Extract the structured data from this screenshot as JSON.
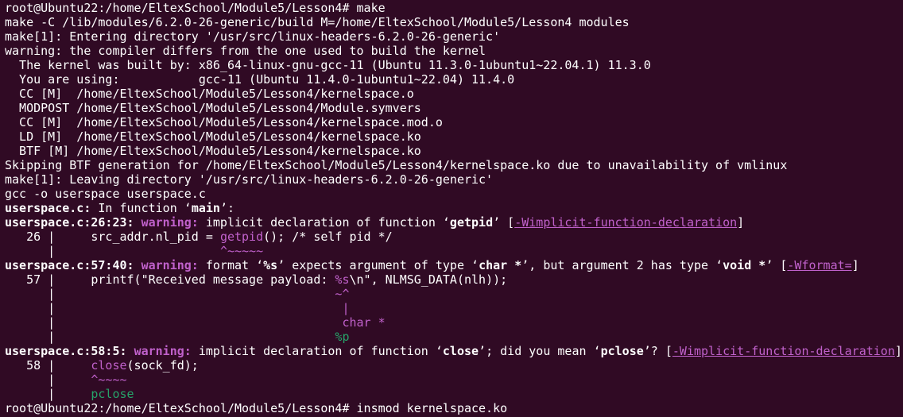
{
  "colors": {
    "background": "#300a24",
    "foreground": "#ffffff",
    "warning": "#c061cb",
    "fixit": "#26a269"
  },
  "lines": [
    [
      {
        "t": "root@Ubuntu22:/home/EltexSchool/Module5/Lesson4# make"
      }
    ],
    [
      {
        "t": "make -C /lib/modules/6.2.0-26-generic/build M=/home/EltexSchool/Module5/Lesson4 modules"
      }
    ],
    [
      {
        "t": "make[1]: Entering directory '/usr/src/linux-headers-6.2.0-26-generic'"
      }
    ],
    [
      {
        "t": "warning: the compiler differs from the one used to build the kernel"
      }
    ],
    [
      {
        "t": "  The kernel was built by: x86_64-linux-gnu-gcc-11 (Ubuntu 11.3.0-1ubuntu1~22.04.1) 11.3.0"
      }
    ],
    [
      {
        "t": "  You are using:           gcc-11 (Ubuntu 11.4.0-1ubuntu1~22.04) 11.4.0"
      }
    ],
    [
      {
        "t": "  CC [M]  /home/EltexSchool/Module5/Lesson4/kernelspace.o"
      }
    ],
    [
      {
        "t": "  MODPOST /home/EltexSchool/Module5/Lesson4/Module.symvers"
      }
    ],
    [
      {
        "t": "  CC [M]  /home/EltexSchool/Module5/Lesson4/kernelspace.mod.o"
      }
    ],
    [
      {
        "t": "  LD [M]  /home/EltexSchool/Module5/Lesson4/kernelspace.ko"
      }
    ],
    [
      {
        "t": "  BTF [M] /home/EltexSchool/Module5/Lesson4/kernelspace.ko"
      }
    ],
    [
      {
        "t": "Skipping BTF generation for /home/EltexSchool/Module5/Lesson4/kernelspace.ko due to unavailability of vmlinux"
      }
    ],
    [
      {
        "t": "make[1]: Leaving directory '/usr/src/linux-headers-6.2.0-26-generic'"
      }
    ],
    [
      {
        "t": "gcc -o userspace userspace.c"
      }
    ],
    [
      {
        "t": "userspace.c:",
        "s": "bold"
      },
      {
        "t": " In function ‘"
      },
      {
        "t": "main",
        "s": "bold"
      },
      {
        "t": "’:"
      }
    ],
    [
      {
        "t": "userspace.c:26:23:",
        "s": "bold"
      },
      {
        "t": " "
      },
      {
        "t": "warning:",
        "s": "warn"
      },
      {
        "t": " implicit declaration of function ‘"
      },
      {
        "t": "getpid",
        "s": "bold"
      },
      {
        "t": "’ ["
      },
      {
        "t": "-Wimplicit-function-declaration",
        "s": "flag"
      },
      {
        "t": "]"
      }
    ],
    [
      {
        "t": "   26 |     src_addr.nl_pid = "
      },
      {
        "t": "getpid",
        "s": "mag"
      },
      {
        "t": "(); /* self pid */"
      }
    ],
    [
      {
        "t": "      |                       "
      },
      {
        "t": "^~~~~~",
        "s": "mag"
      }
    ],
    [
      {
        "t": "userspace.c:57:40:",
        "s": "bold"
      },
      {
        "t": " "
      },
      {
        "t": "warning:",
        "s": "warn"
      },
      {
        "t": " format ‘"
      },
      {
        "t": "%s",
        "s": "bold"
      },
      {
        "t": "’ expects argument of type ‘"
      },
      {
        "t": "char *",
        "s": "bold"
      },
      {
        "t": "’, but argument 2 has type ‘"
      },
      {
        "t": "void *",
        "s": "bold"
      },
      {
        "t": "’ ["
      },
      {
        "t": "-Wformat=",
        "s": "flag"
      },
      {
        "t": "]"
      }
    ],
    [
      {
        "t": "   57 |     printf(\"Received message payload: "
      },
      {
        "t": "%s",
        "s": "mag"
      },
      {
        "t": "\\n\", NLMSG_DATA(nlh));"
      }
    ],
    [
      {
        "t": "      |                                       "
      },
      {
        "t": "~^",
        "s": "mag"
      }
    ],
    [
      {
        "t": "      |                                        "
      },
      {
        "t": "|",
        "s": "mag"
      }
    ],
    [
      {
        "t": "      |                                        "
      },
      {
        "t": "char *",
        "s": "mag"
      }
    ],
    [
      {
        "t": "      |                                       "
      },
      {
        "t": "%p",
        "s": "grn"
      }
    ],
    [
      {
        "t": "userspace.c:58:5:",
        "s": "bold"
      },
      {
        "t": " "
      },
      {
        "t": "warning:",
        "s": "warn"
      },
      {
        "t": " implicit declaration of function ‘"
      },
      {
        "t": "close",
        "s": "bold"
      },
      {
        "t": "’; did you mean ‘"
      },
      {
        "t": "pclose",
        "s": "bold"
      },
      {
        "t": "’? ["
      },
      {
        "t": "-Wimplicit-function-declaration",
        "s": "flag"
      },
      {
        "t": "]"
      }
    ],
    [
      {
        "t": "   58 |     "
      },
      {
        "t": "close",
        "s": "mag"
      },
      {
        "t": "(sock_fd);"
      }
    ],
    [
      {
        "t": "      |     "
      },
      {
        "t": "^~~~~",
        "s": "mag"
      }
    ],
    [
      {
        "t": "      |     "
      },
      {
        "t": "pclose",
        "s": "grn"
      }
    ],
    [
      {
        "t": "root@Ubuntu22:/home/EltexSchool/Module5/Lesson4# insmod kernelspace.ko"
      }
    ]
  ]
}
